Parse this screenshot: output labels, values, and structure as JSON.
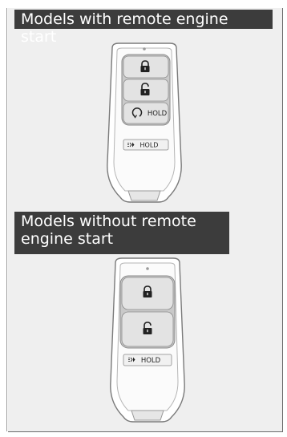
{
  "sections": [
    {
      "heading": "Models with remote engine start",
      "buttons": [
        {
          "icon": "lock-icon"
        },
        {
          "icon": "unlock-icon"
        },
        {
          "icon": "remote-start-icon",
          "label": "HOLD"
        },
        {
          "icon": "trunk-icon",
          "label": "HOLD"
        }
      ]
    },
    {
      "heading": "Models without remote engine start",
      "buttons": [
        {
          "icon": "lock-icon"
        },
        {
          "icon": "unlock-icon"
        },
        {
          "icon": "trunk-icon",
          "label": "HOLD"
        }
      ]
    }
  ],
  "colors": {
    "heading_bg": "#3c3c3c",
    "panel_bg": "#efefef",
    "fob_body": "#ffffff",
    "fob_outline": "#7a7a7a"
  }
}
